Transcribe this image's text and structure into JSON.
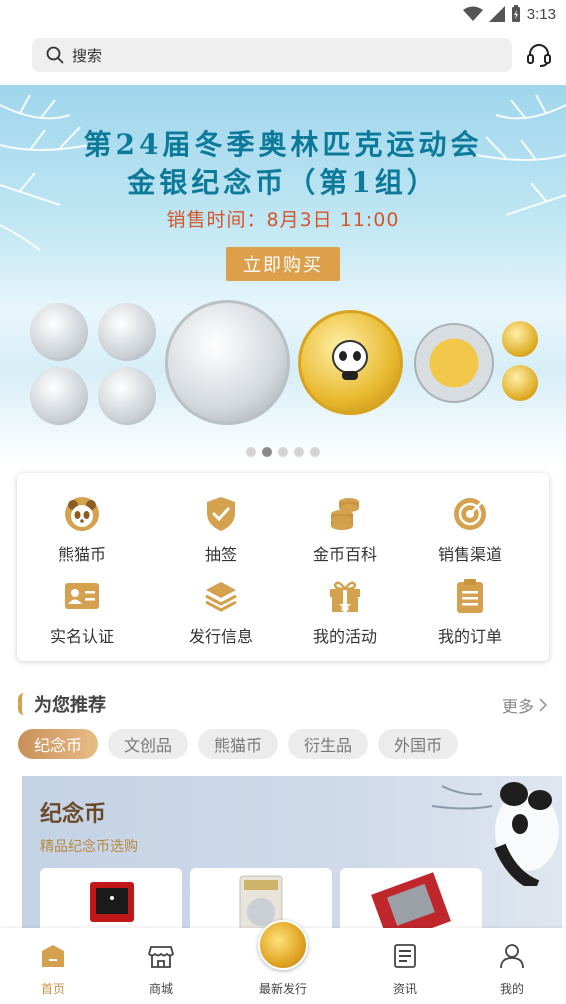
{
  "status_bar": {
    "time": "3:13"
  },
  "search": {
    "placeholder": "搜索"
  },
  "banner": {
    "title_line1": "第24届冬季奥林匹克运动会",
    "title_line2": "金银纪念币（第1组）",
    "sale_time": "销售时间：8月3日 11:00",
    "buy_label": "立即购买",
    "active_slide": 2,
    "slide_count": 5
  },
  "quick_entries": [
    {
      "label": "熊猫币",
      "icon": "panda-icon"
    },
    {
      "label": "抽签",
      "icon": "shield-check-icon"
    },
    {
      "label": "金币百科",
      "icon": "coin-stack-icon"
    },
    {
      "label": "销售渠道",
      "icon": "target-icon"
    },
    {
      "label": "实名认证",
      "icon": "id-card-icon"
    },
    {
      "label": "发行信息",
      "icon": "layers-icon"
    },
    {
      "label": "我的活动",
      "icon": "gift-icon"
    },
    {
      "label": "我的订单",
      "icon": "clipboard-icon"
    }
  ],
  "recommend": {
    "title": "为您推荐",
    "more": "更多",
    "chips": [
      "纪念币",
      "文创品",
      "熊猫币",
      "衍生品",
      "外国币"
    ],
    "active_chip": 0
  },
  "feature": {
    "title": "纪念币",
    "subtitle": "精品纪念币选购"
  },
  "bottom_nav": [
    {
      "label": "首页",
      "icon": "home-icon",
      "active": true
    },
    {
      "label": "商城",
      "icon": "store-icon",
      "active": false
    },
    {
      "label": "最新发行",
      "icon": "coin-icon",
      "active": false
    },
    {
      "label": "资讯",
      "icon": "news-icon",
      "active": false
    },
    {
      "label": "我的",
      "icon": "profile-icon",
      "active": false
    }
  ],
  "colors": {
    "accent": "#c89448",
    "banner_title": "#0e7a9a",
    "sale_text": "#d4562b",
    "buy_button": "#dca04b"
  }
}
